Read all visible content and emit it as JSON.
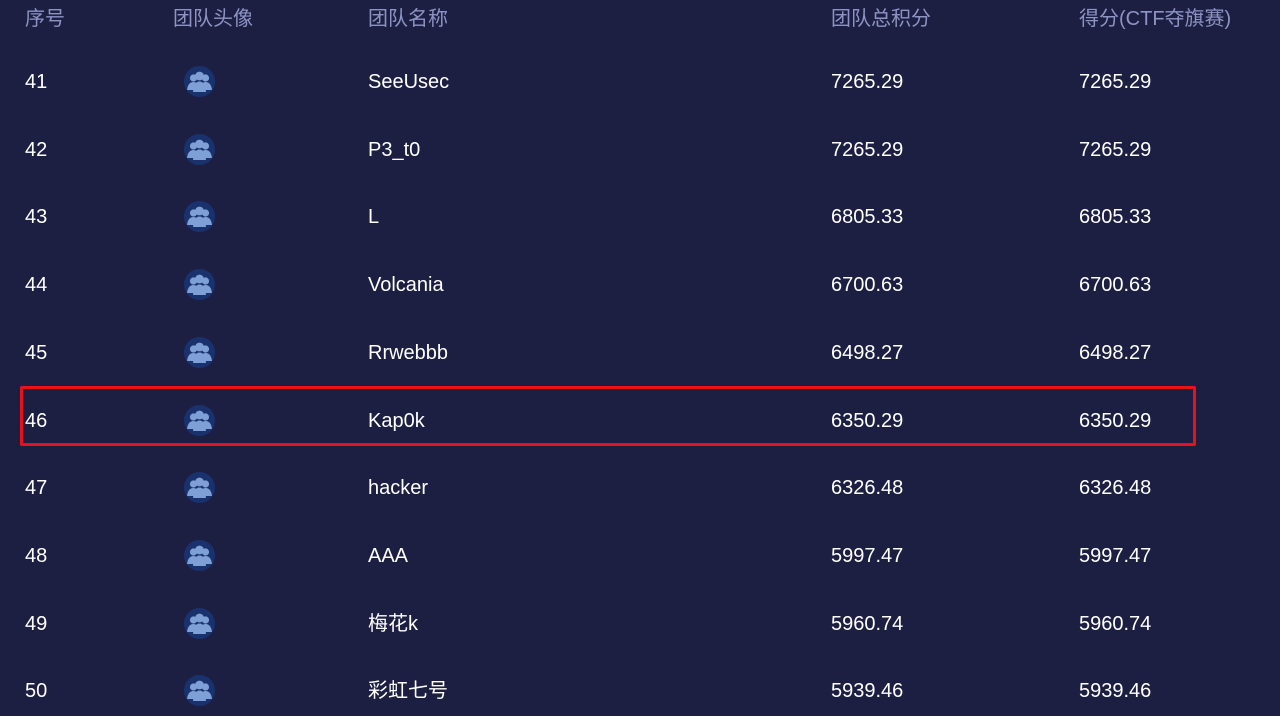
{
  "table": {
    "headers": {
      "rank": "序号",
      "avatar": "团队头像",
      "name": "团队名称",
      "total": "团队总积分",
      "ctf": "得分(CTF夺旗赛)"
    },
    "rows": [
      {
        "rank": "41",
        "name": "SeeUsec",
        "total": "7265.29",
        "ctf": "7265.29"
      },
      {
        "rank": "42",
        "name": "P3_t0",
        "total": "7265.29",
        "ctf": "7265.29"
      },
      {
        "rank": "43",
        "name": "L",
        "total": "6805.33",
        "ctf": "6805.33"
      },
      {
        "rank": "44",
        "name": "Volcania",
        "total": "6700.63",
        "ctf": "6700.63"
      },
      {
        "rank": "45",
        "name": "Rrwebbb",
        "total": "6498.27",
        "ctf": "6498.27"
      },
      {
        "rank": "46",
        "name": "Kap0k",
        "total": "6350.29",
        "ctf": "6350.29",
        "highlighted": true
      },
      {
        "rank": "47",
        "name": "hacker",
        "total": "6326.48",
        "ctf": "6326.48"
      },
      {
        "rank": "48",
        "name": "AAA",
        "total": "5997.47",
        "ctf": "5997.47"
      },
      {
        "rank": "49",
        "name": "梅花k",
        "total": "5960.74",
        "ctf": "5960.74"
      },
      {
        "rank": "50",
        "name": "彩虹七号",
        "total": "5939.46",
        "ctf": "5939.46"
      }
    ]
  },
  "avatar_icon": "team-group-icon",
  "colors": {
    "background": "#1c1f42",
    "header_text": "#8d93c4",
    "row_text": "#ffffff",
    "avatar_bg": "#19326e",
    "avatar_fg": "#7ea0d6",
    "highlight_border": "#e8121b"
  }
}
